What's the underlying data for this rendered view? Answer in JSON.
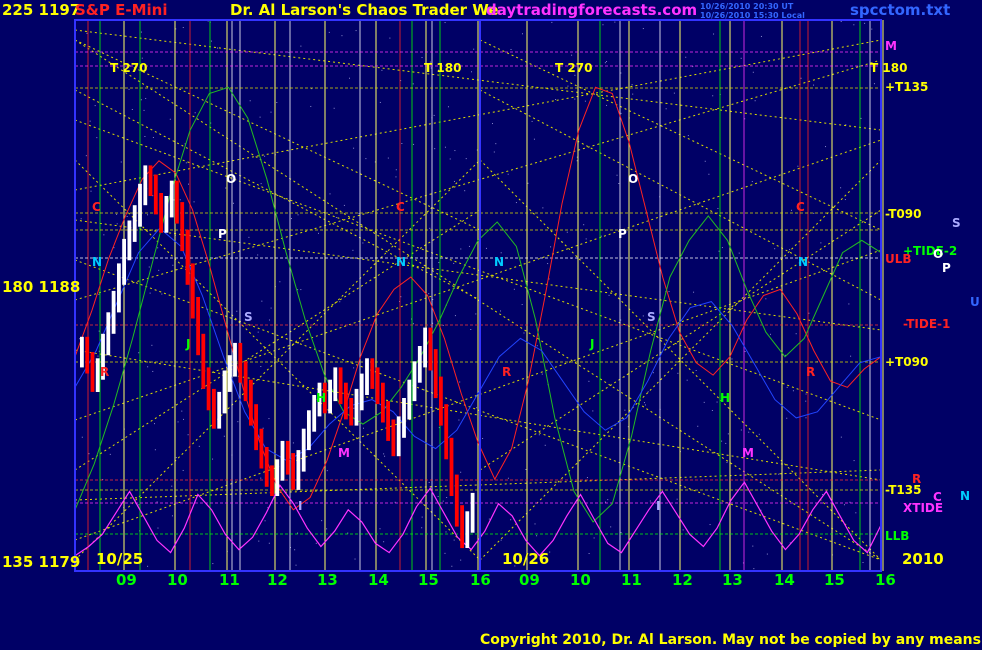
{
  "header": {
    "left_scale": "225 1197",
    "symbol": "S&P E-Mini",
    "title": "Dr. Al Larson's Chaos Trader We",
    "site": "daytradingforecasts.com",
    "stamp_1": "10/26/2010 20:30 UT",
    "stamp_2": "10/26/2010 15:30 Local",
    "file": "spcctom.txt"
  },
  "left_axis": {
    "mid": "180 1188",
    "bottom": "135 1179"
  },
  "footer": {
    "copyright": "Copyright 2010, Dr. Al Larson. May not be copied by any means.",
    "year": "2010"
  },
  "colors": {
    "background": "#000066",
    "plot_border": "#3333ff",
    "price_up": "#ffffff",
    "price_down": "#ff0000",
    "red_line": "#ff2222",
    "green_line": "#22bb22",
    "blue_line": "#2244ff",
    "xtide": "#ff33ff",
    "dotted_yellow": "#dddd00",
    "label_yellow": "#ffff00",
    "label_green": "#00ff00",
    "label_magenta": "#ff33ff"
  },
  "chart_data": {
    "type": "line",
    "title": "S&P E-Mini",
    "y_price_range": [
      1179,
      1197
    ],
    "y_angle_range": [
      135,
      225
    ],
    "sessions": [
      "10/25",
      "10/26"
    ],
    "x_tick_labels": [
      "09",
      "10",
      "11",
      "12",
      "13",
      "14",
      "15",
      "16",
      "09",
      "10",
      "11",
      "12",
      "13",
      "14",
      "15",
      "16"
    ],
    "right_labels": [
      "M",
      "+T135",
      "-T090",
      "+TIDE-2",
      "ULB",
      "-TIDE-1",
      "+T090",
      "-T135",
      "XTIDE",
      "LLB"
    ],
    "right_edge_letters": [
      "S",
      "O",
      "P",
      "U",
      "C",
      "N"
    ],
    "markers": [
      "T 270",
      "T 180",
      "T 270",
      "T 180",
      "O",
      "P",
      "S",
      "C",
      "N",
      "J",
      "R",
      "H",
      "M",
      "I"
    ],
    "price_close_series": [
      1186.3,
      1185.8,
      1185.2,
      1185.6,
      1186.4,
      1187.1,
      1187.8,
      1188.7,
      1189.5,
      1190.1,
      1190.6,
      1191.3,
      1191.9,
      1191.6,
      1191.0,
      1190.4,
      1190.9,
      1191.4,
      1190.7,
      1189.8,
      1188.7,
      1187.6,
      1186.4,
      1185.3,
      1184.6,
      1184.0,
      1184.5,
      1185.2,
      1185.7,
      1186.1,
      1185.5,
      1184.9,
      1184.1,
      1183.3,
      1182.7,
      1182.1,
      1181.8,
      1182.3,
      1182.9,
      1182.5,
      1182.0,
      1182.6,
      1183.3,
      1183.9,
      1184.4,
      1184.8,
      1184.5,
      1184.9,
      1185.3,
      1184.8,
      1184.3,
      1184.1,
      1184.6,
      1185.1,
      1185.6,
      1185.3,
      1184.8,
      1184.2,
      1183.6,
      1183.1,
      1183.7,
      1184.3,
      1184.9,
      1185.5,
      1186.0,
      1186.6,
      1185.9,
      1185.0,
      1184.1,
      1183.0,
      1181.8,
      1180.8,
      1180.1,
      1180.6,
      1181.2
    ],
    "xtide_series": [
      1179.5,
      1179.8,
      1180.2,
      1180.9,
      1181.6,
      1180.8,
      1180.0,
      1179.6,
      1180.4,
      1181.5,
      1181.0,
      1180.2,
      1179.7,
      1180.1,
      1180.9,
      1181.8,
      1181.2,
      1180.4,
      1179.8,
      1180.3,
      1181.0,
      1180.6,
      1179.9,
      1179.6,
      1180.2,
      1181.1,
      1181.7,
      1180.9,
      1180.1,
      1179.7,
      1180.3,
      1181.2,
      1180.8,
      1180.0,
      1179.5,
      1180.0,
      1180.8,
      1181.5,
      1180.7,
      1179.9,
      1179.6,
      1180.3,
      1181.0,
      1181.6,
      1180.9,
      1180.2,
      1179.8,
      1180.4,
      1181.3,
      1181.9,
      1181.1,
      1180.3,
      1179.7,
      1180.2,
      1181.0,
      1181.6,
      1180.8,
      1180.0,
      1179.6,
      1180.5
    ],
    "red_series": [
      1186.0,
      1187.5,
      1189.2,
      1190.6,
      1191.8,
      1192.4,
      1192.0,
      1190.8,
      1189.0,
      1187.0,
      1185.0,
      1183.2,
      1181.8,
      1181.0,
      1181.4,
      1182.6,
      1184.2,
      1186.0,
      1187.4,
      1188.2,
      1188.6,
      1188.0,
      1186.6,
      1184.8,
      1183.2,
      1182.0,
      1183.0,
      1185.2,
      1188.0,
      1191.0,
      1193.4,
      1194.8,
      1194.6,
      1193.0,
      1190.8,
      1188.6,
      1186.8,
      1185.8,
      1185.4,
      1186.0,
      1187.2,
      1188.0,
      1188.2,
      1187.4,
      1186.2,
      1185.2,
      1185.0,
      1185.6,
      1186.0
    ],
    "green_series": [
      1181.0,
      1182.5,
      1184.4,
      1186.6,
      1189.0,
      1191.4,
      1193.4,
      1194.6,
      1194.8,
      1193.8,
      1191.8,
      1189.4,
      1187.2,
      1185.4,
      1184.2,
      1183.8,
      1184.2,
      1185.0,
      1186.0,
      1187.2,
      1188.6,
      1189.8,
      1190.4,
      1189.6,
      1187.2,
      1184.0,
      1181.6,
      1180.6,
      1181.2,
      1183.4,
      1186.2,
      1188.6,
      1189.8,
      1190.6,
      1189.8,
      1188.2,
      1186.8,
      1186.0,
      1186.6,
      1188.0,
      1189.4,
      1189.8,
      1189.4
    ],
    "blue_series": [
      1185.0,
      1186.2,
      1187.8,
      1189.4,
      1190.2,
      1189.6,
      1188.0,
      1186.0,
      1184.2,
      1183.0,
      1182.6,
      1183.0,
      1183.8,
      1184.4,
      1184.6,
      1184.2,
      1183.4,
      1183.0,
      1183.6,
      1184.8,
      1186.0,
      1186.6,
      1186.2,
      1185.2,
      1184.2,
      1183.6,
      1184.0,
      1185.2,
      1186.6,
      1187.6,
      1187.8,
      1187.0,
      1185.8,
      1184.6,
      1184.0,
      1184.2,
      1185.0,
      1185.8,
      1186.0
    ]
  }
}
